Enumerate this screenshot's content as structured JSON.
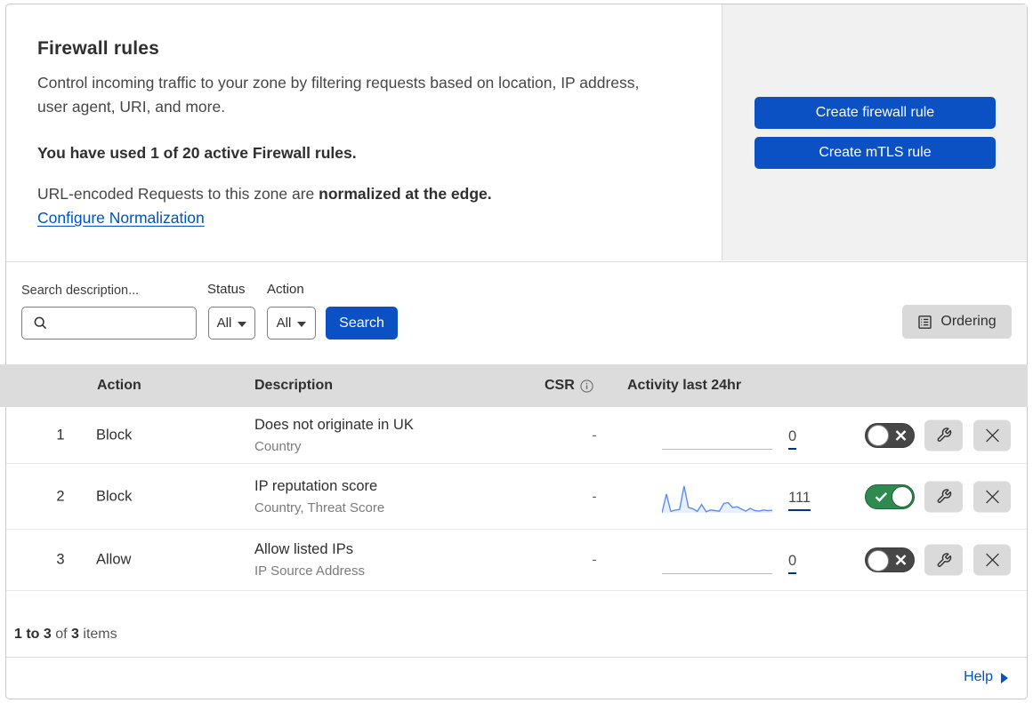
{
  "header": {
    "title": "Firewall rules",
    "description": "Control incoming traffic to your zone by filtering requests based on location, IP address, user agent, URI, and more.",
    "usage_note": "You have used 1 of 20 active Firewall rules.",
    "normalization_text": "URL-encoded Requests to this zone are ",
    "normalization_bold": "normalized at the edge.",
    "normalization_link": "Configure Normalization",
    "create_firewall_rule_label": "Create firewall rule",
    "create_mtls_rule_label": "Create mTLS rule"
  },
  "filters": {
    "search_label": "Search description...",
    "search_value": "",
    "status_label": "Status",
    "status_value": "All",
    "action_label": "Action",
    "action_value": "All",
    "search_button_label": "Search",
    "ordering_button_label": "Ordering"
  },
  "table": {
    "headers": {
      "action": "Action",
      "description": "Description",
      "csr": "CSR",
      "activity": "Activity last 24hr"
    },
    "rows": [
      {
        "num": "1",
        "action": "Block",
        "description": "Does not originate in UK",
        "criteria": "Country",
        "csr": "-",
        "activity_count": "0",
        "enabled": false
      },
      {
        "num": "2",
        "action": "Block",
        "description": "IP reputation score",
        "criteria": "Country, Threat Score",
        "csr": "-",
        "activity_count": "111",
        "enabled": true
      },
      {
        "num": "3",
        "action": "Allow",
        "description": "Allow listed IPs",
        "criteria": "IP Source Address",
        "csr": "-",
        "activity_count": "0",
        "enabled": false
      }
    ]
  },
  "pagination": {
    "range": "1 to 3",
    "of_text": " of ",
    "total": "3",
    "items_text": " items"
  },
  "help_label": "Help",
  "colors": {
    "accent_blue": "#0b51c4",
    "link_blue": "#0051c3",
    "toggle_green": "#2e8a4f",
    "toggle_gray": "#474747",
    "spark_line": "#5b8def",
    "count_underline": "#003681"
  },
  "chart_data": [
    {
      "type": "area",
      "row": 1,
      "title": "Activity last 24hr - rule 1 (flat, zero requests)",
      "total": 0,
      "values": [
        0,
        0,
        0,
        0,
        0,
        0,
        0,
        0,
        0,
        0,
        0,
        0,
        0,
        0,
        0,
        0,
        0,
        0,
        0,
        0,
        0,
        0,
        0,
        0,
        0,
        0
      ]
    },
    {
      "type": "area",
      "row": 2,
      "title": "Activity last 24hr - rule 2 sparkline (relative request volume)",
      "total": 111,
      "ylim": [
        0,
        1
      ],
      "values": [
        0,
        0.68,
        0.05,
        0.1,
        0.12,
        0.97,
        0.19,
        0.15,
        0.05,
        0.3,
        0.04,
        0.1,
        0.08,
        0.06,
        0.34,
        0.37,
        0.19,
        0.22,
        0.14,
        0.06,
        0.16,
        0.08,
        0.06,
        0.1,
        0.08,
        0.09
      ]
    },
    {
      "type": "area",
      "row": 3,
      "title": "Activity last 24hr - rule 3 (flat, zero requests)",
      "total": 0,
      "values": [
        0,
        0,
        0,
        0,
        0,
        0,
        0,
        0,
        0,
        0,
        0,
        0,
        0,
        0,
        0,
        0,
        0,
        0,
        0,
        0,
        0,
        0,
        0,
        0,
        0,
        0
      ]
    }
  ]
}
